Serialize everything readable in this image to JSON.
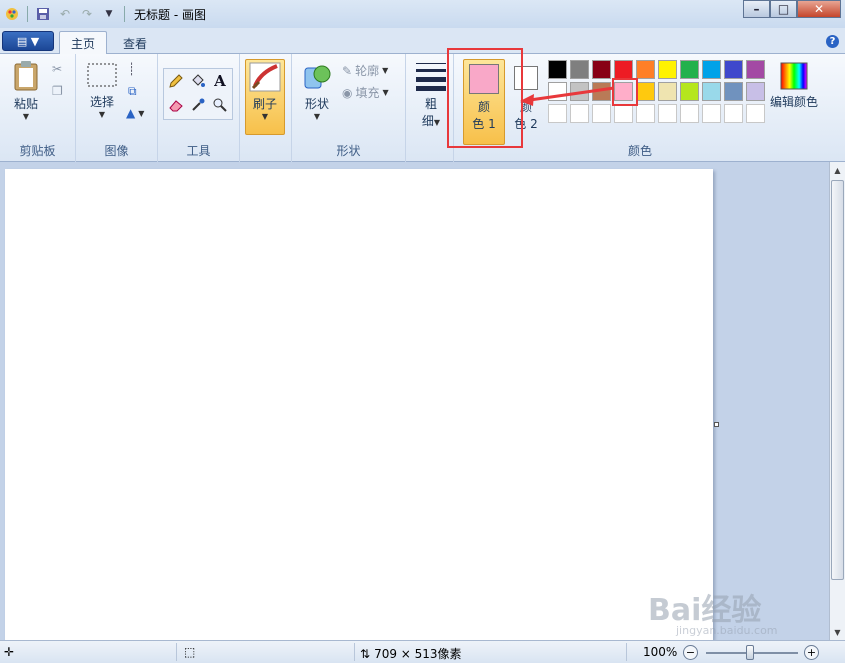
{
  "window": {
    "title": "无标题 - 画图"
  },
  "tabs": [
    {
      "label": "主页",
      "active": true
    },
    {
      "label": "查看",
      "active": false
    }
  ],
  "ribbon": {
    "clipboard": {
      "group_label": "剪贴板",
      "paste_label": "粘贴"
    },
    "image": {
      "group_label": "图像",
      "select_label": "选择"
    },
    "tools": {
      "group_label": "工具",
      "text_tool_glyph": "A"
    },
    "brushes": {
      "label": "刷子"
    },
    "shapes": {
      "group_label": "形状",
      "shapes_label": "形状",
      "outline_label": "轮廓",
      "fill_label": "填充"
    },
    "size": {
      "label_line1": "粗",
      "label_line2": "细"
    },
    "colors": {
      "group_label": "颜色",
      "color1_line1": "颜",
      "color1_line2": "色 1",
      "color2_line1": "颜",
      "color2_line2": "色 2",
      "edit_colors_label": "编辑颜色",
      "color1_value": "#f9a8c8",
      "color2_value": "#ffffff",
      "palette": [
        "#000000",
        "#7f7f7f",
        "#880015",
        "#ed1c24",
        "#ff7f27",
        "#fff200",
        "#22b14c",
        "#00a2e8",
        "#3f48cc",
        "#a349a4",
        "#ffffff",
        "#c3c3c3",
        "#b97a57",
        "#ffaec9",
        "#ffc90e",
        "#efe4b0",
        "#b5e61d",
        "#99d9ea",
        "#7092be",
        "#c8bfe7",
        "#ffffff",
        "#ffffff",
        "#ffffff",
        "#ffffff",
        "#ffffff",
        "#ffffff",
        "#ffffff",
        "#ffffff",
        "#ffffff",
        "#ffffff"
      ]
    }
  },
  "annotation": {
    "highlight_color": "#e8383b"
  },
  "statusbar": {
    "canvas_size": "709 × 513像素",
    "zoom": "100%"
  },
  "watermark": {
    "main": "Bai经验",
    "sub": "jingyan.baidu.com"
  }
}
